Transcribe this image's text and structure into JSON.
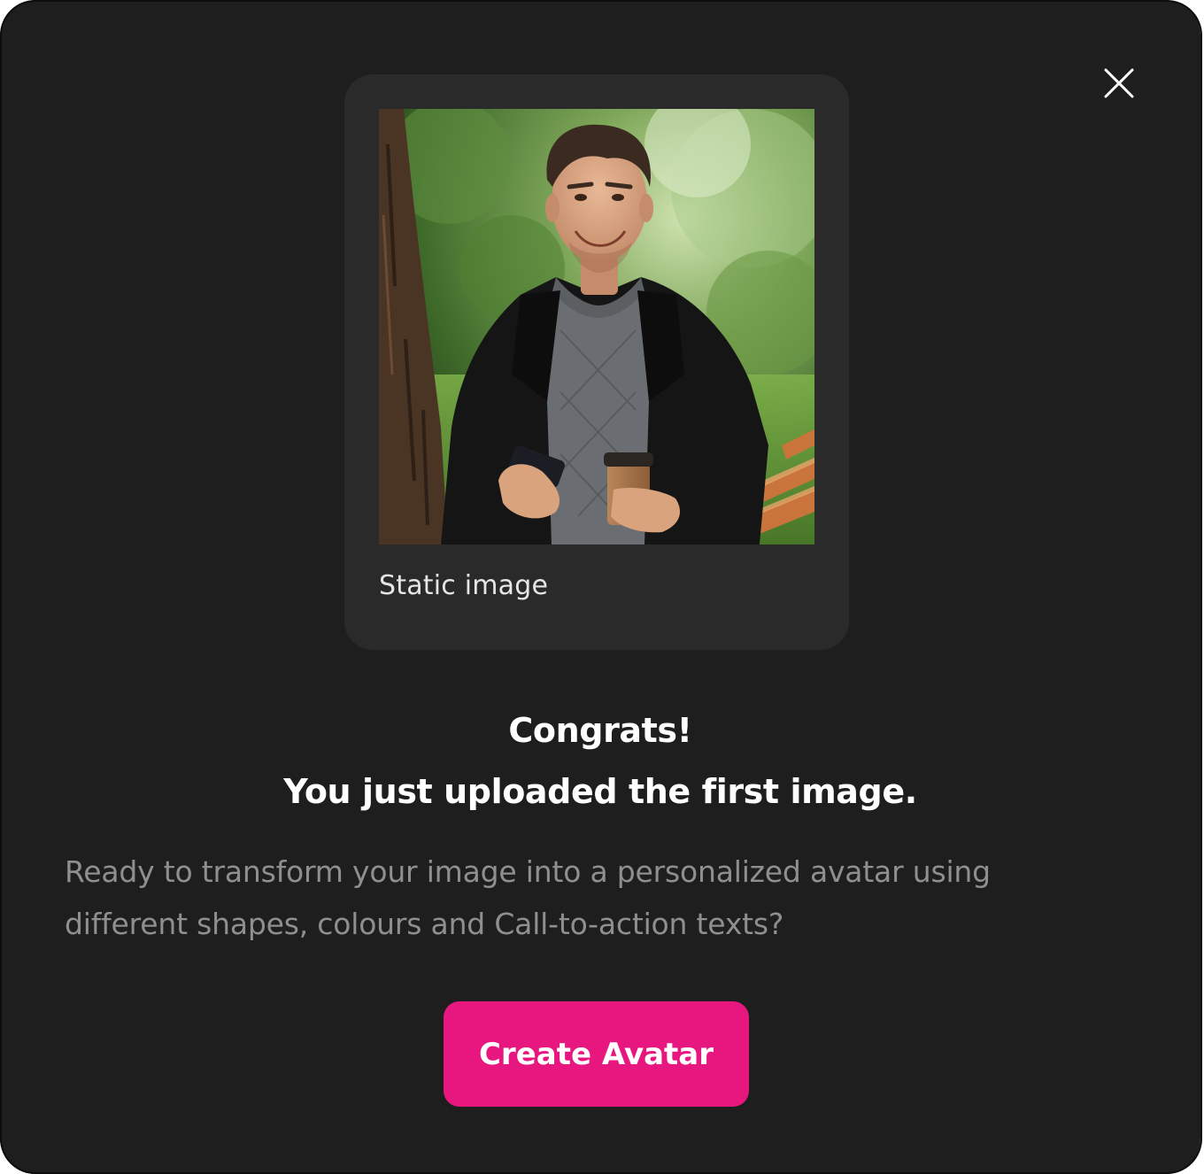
{
  "modal": {
    "close_icon": "close-icon",
    "preview": {
      "label": "Static image",
      "image_description_icon": "photo-placeholder"
    },
    "headline_line1": "Congrats!",
    "headline_line2": "You just uploaded the first image.",
    "description": "Ready to transform your image into a personalized avatar using different shapes, colours and Call-to-action texts?",
    "cta_label": "Create Avatar"
  },
  "colors": {
    "background": "#1e1e1e",
    "card": "#2a2a2a",
    "accent": "#e8177f",
    "text_primary": "#ffffff",
    "text_secondary": "#8f8f8f"
  }
}
